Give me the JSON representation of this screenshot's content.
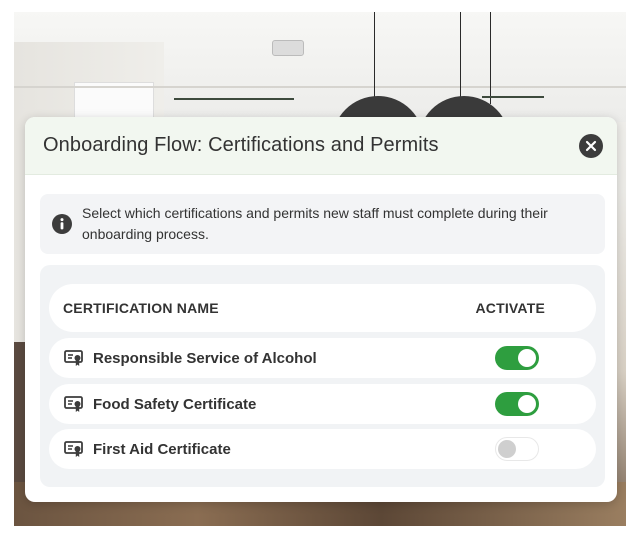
{
  "modal": {
    "title": "Onboarding Flow: Certifications and Permits",
    "close_icon": "close-icon"
  },
  "info": {
    "icon": "info-icon",
    "text": "Select which certifications and permits new staff must complete during their onboarding process."
  },
  "table": {
    "headers": {
      "name": "CERTIFICATION NAME",
      "activate": "ACTIVATE"
    },
    "rows": [
      {
        "label": "Responsible Service of Alcohol",
        "icon": "certificate-icon",
        "active": true
      },
      {
        "label": "Food Safety Certificate",
        "icon": "certificate-icon",
        "active": true
      },
      {
        "label": "First Aid Certificate",
        "icon": "certificate-icon",
        "active": false
      }
    ]
  },
  "colors": {
    "toggle_on": "#2e9e3f",
    "header_bg": "#f2f7f0",
    "panel_bg": "#f1f3f5"
  }
}
